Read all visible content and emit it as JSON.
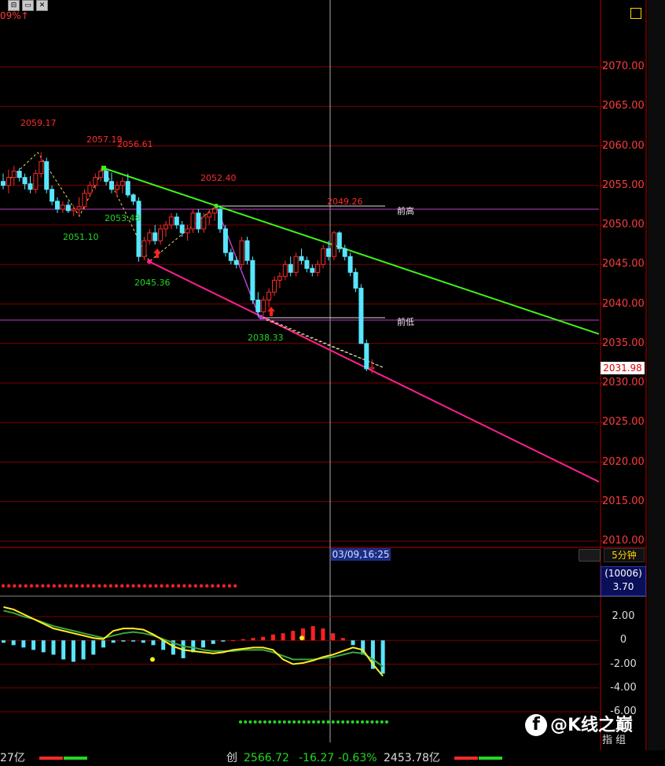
{
  "header": {
    "pct_text": "09%↑",
    "window_buttons": [
      "⊟",
      "▭",
      "✕"
    ]
  },
  "chart_data": {
    "type": "candlestick",
    "y_axis": {
      "labels": [
        "2070.00",
        "2065.00",
        "2060.00",
        "2055.00",
        "2050.00",
        "2045.00",
        "2040.00",
        "2035.00",
        "2030.00",
        "2025.00",
        "2020.00",
        "2015.00",
        "2010.00"
      ],
      "ylim": [
        2010,
        2070
      ]
    },
    "last_price": "2031.98",
    "crosshair_time": "03/09,16:25",
    "period": "5分钟",
    "candles": [
      [
        2055.5,
        2056.5,
        2054.5,
        2055.0
      ],
      [
        2055.0,
        2057.0,
        2054.0,
        2056.0
      ],
      [
        2056.0,
        2057.5,
        2055.0,
        2056.8
      ],
      [
        2056.8,
        2057.2,
        2055.5,
        2056.0
      ],
      [
        2056.0,
        2056.5,
        2054.5,
        2055.2
      ],
      [
        2055.2,
        2056.2,
        2054.0,
        2054.5
      ],
      [
        2054.5,
        2057.0,
        2054.0,
        2056.5
      ],
      [
        2056.5,
        2059.17,
        2056.0,
        2058.0
      ],
      [
        2058.0,
        2058.5,
        2054.0,
        2054.5
      ],
      [
        2054.5,
        2055.0,
        2052.5,
        2053.0
      ],
      [
        2053.0,
        2053.5,
        2051.5,
        2052.0
      ],
      [
        2052.0,
        2053.0,
        2051.5,
        2052.5
      ],
      [
        2052.5,
        2053.0,
        2051.5,
        2051.8
      ],
      [
        2051.8,
        2052.5,
        2051.1,
        2052.0
      ],
      [
        2052.0,
        2053.5,
        2051.1,
        2052.3
      ],
      [
        2052.3,
        2054.5,
        2052.0,
        2054.0
      ],
      [
        2054.0,
        2055.5,
        2053.5,
        2055.0
      ],
      [
        2055.0,
        2056.5,
        2054.5,
        2056.0
      ],
      [
        2056.0,
        2057.19,
        2055.5,
        2056.8
      ],
      [
        2056.8,
        2057.0,
        2055.0,
        2055.5
      ],
      [
        2055.5,
        2056.61,
        2054.0,
        2054.5
      ],
      [
        2054.5,
        2055.5,
        2053.5,
        2055.0
      ],
      [
        2055.0,
        2056.0,
        2054.0,
        2055.5
      ],
      [
        2055.5,
        2056.5,
        2053.48,
        2053.8
      ],
      [
        2053.8,
        2054.0,
        2052.5,
        2053.0
      ],
      [
        2053.0,
        2053.5,
        2045.36,
        2046.0
      ],
      [
        2046.0,
        2048.5,
        2045.5,
        2048.0
      ],
      [
        2048.0,
        2049.5,
        2047.5,
        2049.0
      ],
      [
        2049.0,
        2050.0,
        2047.5,
        2048.0
      ],
      [
        2048.0,
        2050.0,
        2047.5,
        2049.5
      ],
      [
        2049.5,
        2050.5,
        2048.5,
        2050.0
      ],
      [
        2050.0,
        2051.5,
        2049.5,
        2051.0
      ],
      [
        2051.0,
        2051.5,
        2049.5,
        2050.0
      ],
      [
        2050.0,
        2050.5,
        2048.5,
        2049.0
      ],
      [
        2049.0,
        2050.0,
        2048.0,
        2049.5
      ],
      [
        2049.5,
        2052.0,
        2049.0,
        2051.5
      ],
      [
        2051.5,
        2052.0,
        2049.0,
        2049.5
      ],
      [
        2049.5,
        2051.5,
        2049.0,
        2051.0
      ],
      [
        2051.0,
        2052.0,
        2050.0,
        2051.5
      ],
      [
        2051.5,
        2052.4,
        2050.5,
        2052.0
      ],
      [
        2052.0,
        2052.2,
        2049.0,
        2049.5
      ],
      [
        2049.5,
        2050.0,
        2046.0,
        2046.5
      ],
      [
        2046.5,
        2047.0,
        2045.0,
        2045.5
      ],
      [
        2045.5,
        2046.0,
        2044.5,
        2045.0
      ],
      [
        2045.0,
        2048.5,
        2044.5,
        2048.0
      ],
      [
        2048.0,
        2048.5,
        2045.0,
        2045.5
      ],
      [
        2045.5,
        2046.0,
        2040.0,
        2040.5
      ],
      [
        2040.5,
        2041.5,
        2038.33,
        2039.0
      ],
      [
        2039.0,
        2041.0,
        2038.5,
        2040.5
      ],
      [
        2040.5,
        2042.0,
        2039.5,
        2041.5
      ],
      [
        2041.5,
        2043.5,
        2041.0,
        2043.0
      ],
      [
        2043.0,
        2044.0,
        2042.0,
        2043.5
      ],
      [
        2043.5,
        2045.5,
        2043.0,
        2045.0
      ],
      [
        2045.0,
        2046.0,
        2043.5,
        2044.0
      ],
      [
        2044.0,
        2046.5,
        2043.5,
        2046.0
      ],
      [
        2046.0,
        2047.0,
        2045.0,
        2045.5
      ],
      [
        2045.5,
        2046.0,
        2044.0,
        2044.5
      ],
      [
        2044.5,
        2045.0,
        2043.5,
        2044.0
      ],
      [
        2044.0,
        2045.5,
        2043.5,
        2045.0
      ],
      [
        2045.0,
        2047.5,
        2044.5,
        2047.0
      ],
      [
        2047.0,
        2048.0,
        2045.5,
        2046.0
      ],
      [
        2046.0,
        2049.26,
        2045.5,
        2049.0
      ],
      [
        2049.0,
        2049.2,
        2046.5,
        2047.0
      ],
      [
        2047.0,
        2047.5,
        2045.5,
        2046.0
      ],
      [
        2046.0,
        2046.5,
        2043.5,
        2044.0
      ],
      [
        2044.0,
        2044.5,
        2041.5,
        2042.0
      ],
      [
        2042.0,
        2042.5,
        2035.0,
        2035.0
      ],
      [
        2035.0,
        2035.5,
        2031.5,
        2031.8
      ],
      [
        2031.8,
        2033.0,
        2031.2,
        2031.98
      ]
    ],
    "annotations": {
      "highs": [
        "2059.17",
        "2057.19",
        "2056.61",
        "2052.40",
        "2049.26"
      ],
      "lows": [
        "2053.48",
        "2051.10",
        "2045.36",
        "2038.33"
      ],
      "prev_high": "前高",
      "prev_low": "前低"
    },
    "indicator": {
      "name": "(10006)",
      "value": "3.70",
      "y_labels": [
        "2.00",
        "0",
        "-2.00",
        "-4.00",
        "-6.00"
      ],
      "ylim": [
        -6,
        2
      ],
      "hist": [
        -0.2,
        -0.4,
        -0.6,
        -0.8,
        -1.0,
        -1.2,
        -1.6,
        -1.8,
        -1.6,
        -1.2,
        -0.6,
        -0.2,
        -0.1,
        -0.1,
        -0.2,
        -0.4,
        -0.8,
        -1.2,
        -1.5,
        -1.0,
        -0.6,
        -0.3,
        -0.1,
        0,
        0.1,
        0.2,
        0.3,
        0.5,
        0.6,
        0.8,
        1.0,
        1.2,
        1.0,
        0.6,
        0.2,
        -0.4,
        -1.2,
        -2.4,
        -2.8
      ],
      "lines": {
        "yellow": [
          2.8,
          2.6,
          2.2,
          1.8,
          1.4,
          1.0,
          0.8,
          0.6,
          0.4,
          0.2,
          0.1,
          0.8,
          1.0,
          1.0,
          0.9,
          0.5,
          0.0,
          -0.5,
          -0.8,
          -0.9,
          -1.0,
          -1.1,
          -1.0,
          -0.8,
          -0.7,
          -0.6,
          -0.6,
          -0.8,
          -1.6,
          -2.0,
          -1.9,
          -1.7,
          -1.4,
          -1.2,
          -0.9,
          -0.6,
          -0.8,
          -2.0,
          -3.0
        ],
        "green": [
          2.5,
          2.3,
          2.0,
          1.8,
          1.5,
          1.2,
          1.0,
          0.8,
          0.6,
          0.4,
          0.2,
          0.4,
          0.6,
          0.7,
          0.6,
          0.4,
          0.1,
          -0.2,
          -0.5,
          -0.6,
          -0.8,
          -0.9,
          -0.9,
          -0.9,
          -0.8,
          -0.8,
          -0.8,
          -1.0,
          -1.3,
          -1.6,
          -1.6,
          -1.6,
          -1.5,
          -1.4,
          -1.2,
          -1.0,
          -1.1,
          -1.6,
          -2.2
        ]
      }
    }
  },
  "status": {
    "left_amount": "27亿",
    "board": "创",
    "index": "2566.72",
    "change": "-16.27",
    "change_pct": "-0.63%",
    "turnover": "2453.78亿"
  },
  "watermark": "@K线之巅",
  "bottom_hint": "指 组",
  "colors": {
    "up": "#ff2a2a",
    "down": "#58e6ff",
    "grid": "#7a0000",
    "trend_green": "#3ff21a",
    "trend_pink": "#ff1f8f"
  }
}
